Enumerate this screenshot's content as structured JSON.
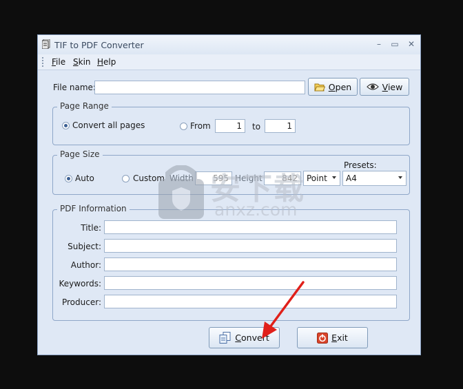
{
  "window": {
    "title": "TIF to PDF Converter",
    "min": "–",
    "max": "▭",
    "close": "✕"
  },
  "menu": {
    "file": "File",
    "skin": "Skin",
    "help": "Help"
  },
  "file": {
    "label": "File name:",
    "value": "",
    "open": "Open",
    "view": "View"
  },
  "page_range": {
    "title": "Page Range",
    "all": "Convert all pages",
    "from_label": "From",
    "from_value": "1",
    "to_label": "to",
    "to_value": "1",
    "selected": "all"
  },
  "page_size": {
    "title": "Page Size",
    "auto": "Auto",
    "custom": "Custom",
    "width_label": "Width",
    "width_value": "595",
    "height_label": "Height",
    "height_value": "842",
    "unit": "Point",
    "presets_label": "Presets:",
    "preset": "A4",
    "selected": "auto"
  },
  "pdf_info": {
    "title": "PDF Information",
    "title_label": "Title:",
    "subject_label": "Subject:",
    "author_label": "Author:",
    "keywords_label": "Keywords:",
    "producer_label": "Producer:"
  },
  "actions": {
    "convert": "Convert",
    "exit": "Exit"
  },
  "watermark": {
    "cn": "安下载",
    "en": "anxz.com"
  },
  "colors": {
    "accent": "#3b5f93",
    "arrow": "#e0201a",
    "exit_icon": "#d9452b"
  }
}
